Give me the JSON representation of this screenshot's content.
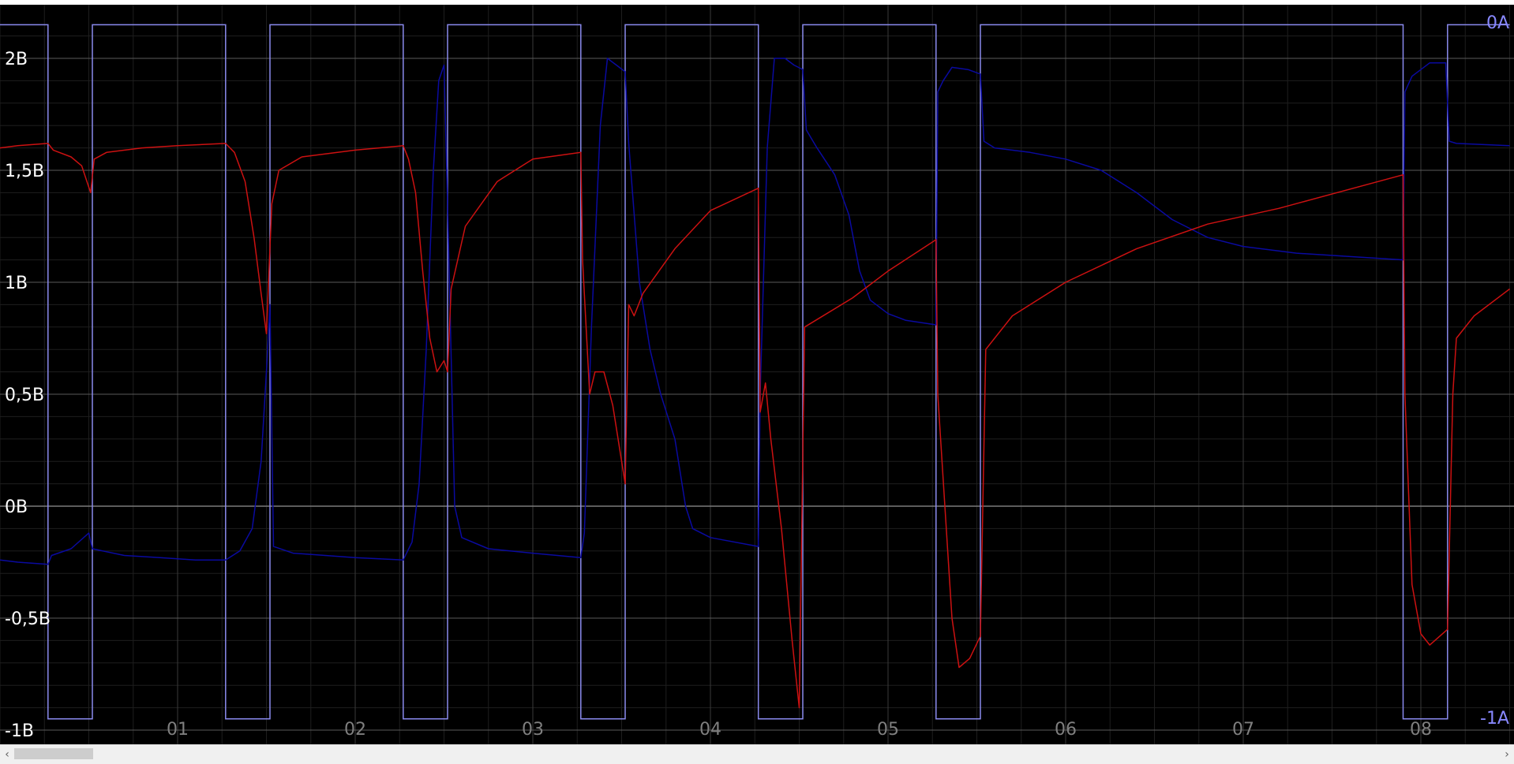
{
  "chart_data": {
    "type": "line",
    "title": "",
    "xlabel": "",
    "ylabel": "",
    "background": "#000000",
    "grid": true,
    "legend": "none",
    "xlim": [
      0,
      8.5
    ],
    "ylim": [
      -1.0,
      2.15
    ],
    "x_ticks": [
      {
        "value": 1,
        "label": "01"
      },
      {
        "value": 2,
        "label": "02"
      },
      {
        "value": 3,
        "label": "03"
      },
      {
        "value": 4,
        "label": "04"
      },
      {
        "value": 5,
        "label": "05"
      },
      {
        "value": 6,
        "label": "06"
      },
      {
        "value": 7,
        "label": "07"
      },
      {
        "value": 8,
        "label": "08"
      }
    ],
    "y_ticks": [
      {
        "value": 2,
        "label": "2В"
      },
      {
        "value": 1.5,
        "label": "1,5В"
      },
      {
        "value": 1,
        "label": "1В"
      },
      {
        "value": 0.5,
        "label": "0,5В"
      },
      {
        "value": 0,
        "label": "0В"
      },
      {
        "value": -0.5,
        "label": "-0,5В"
      },
      {
        "value": -1,
        "label": "-1В"
      }
    ],
    "y2_ticks": [
      {
        "value": 2.15,
        "label": "0A"
      },
      {
        "value": -0.95,
        "label": "-1A"
      }
    ],
    "series": [
      {
        "color": "#8a8aee",
        "style": "square",
        "high": 2.15,
        "low": -0.95,
        "low_intervals": [
          [
            0.27,
            0.52
          ],
          [
            1.27,
            1.52
          ],
          [
            2.27,
            2.52
          ],
          [
            3.27,
            3.52
          ],
          [
            4.27,
            4.52
          ],
          [
            5.27,
            5.52
          ],
          [
            7.9,
            8.15
          ]
        ]
      },
      {
        "color": "#0a0aa0",
        "points": [
          [
            0,
            -0.24
          ],
          [
            0.1,
            -0.25
          ],
          [
            0.27,
            -0.26
          ],
          [
            0.29,
            -0.22
          ],
          [
            0.4,
            -0.19
          ],
          [
            0.5,
            -0.12
          ],
          [
            0.52,
            -0.19
          ],
          [
            0.7,
            -0.22
          ],
          [
            0.9,
            -0.23
          ],
          [
            1.1,
            -0.24
          ],
          [
            1.27,
            -0.24
          ],
          [
            1.35,
            -0.2
          ],
          [
            1.42,
            -0.1
          ],
          [
            1.47,
            0.2
          ],
          [
            1.5,
            0.6
          ],
          [
            1.52,
            0.9
          ],
          [
            1.54,
            -0.18
          ],
          [
            1.65,
            -0.21
          ],
          [
            2,
            -0.23
          ],
          [
            2.27,
            -0.24
          ],
          [
            2.32,
            -0.16
          ],
          [
            2.36,
            0.1
          ],
          [
            2.4,
            0.7
          ],
          [
            2.44,
            1.5
          ],
          [
            2.47,
            1.9
          ],
          [
            2.5,
            1.97
          ],
          [
            2.52,
            1.35
          ],
          [
            2.56,
            0.0
          ],
          [
            2.6,
            -0.14
          ],
          [
            2.75,
            -0.19
          ],
          [
            3,
            -0.21
          ],
          [
            3.27,
            -0.23
          ],
          [
            3.29,
            -0.12
          ],
          [
            3.33,
            0.8
          ],
          [
            3.38,
            1.7
          ],
          [
            3.42,
            2.0
          ],
          [
            3.47,
            1.97
          ],
          [
            3.52,
            1.94
          ],
          [
            3.54,
            1.62
          ],
          [
            3.6,
            1.0
          ],
          [
            3.66,
            0.7
          ],
          [
            3.72,
            0.5
          ],
          [
            3.8,
            0.3
          ],
          [
            3.86,
            0.0
          ],
          [
            3.9,
            -0.1
          ],
          [
            4,
            -0.14
          ],
          [
            4.27,
            -0.18
          ],
          [
            4.28,
            0.5
          ],
          [
            4.32,
            1.6
          ],
          [
            4.36,
            2.0
          ],
          [
            4.42,
            2.0
          ],
          [
            4.47,
            1.97
          ],
          [
            4.52,
            1.95
          ],
          [
            4.54,
            1.68
          ],
          [
            4.6,
            1.6
          ],
          [
            4.7,
            1.48
          ],
          [
            4.78,
            1.3
          ],
          [
            4.84,
            1.05
          ],
          [
            4.9,
            0.92
          ],
          [
            5,
            0.86
          ],
          [
            5.1,
            0.83
          ],
          [
            5.27,
            0.81
          ],
          [
            5.28,
            1.85
          ],
          [
            5.31,
            1.9
          ],
          [
            5.36,
            1.96
          ],
          [
            5.45,
            1.95
          ],
          [
            5.52,
            1.93
          ],
          [
            5.54,
            1.63
          ],
          [
            5.6,
            1.6
          ],
          [
            5.8,
            1.58
          ],
          [
            6,
            1.55
          ],
          [
            6.2,
            1.5
          ],
          [
            6.4,
            1.4
          ],
          [
            6.6,
            1.28
          ],
          [
            6.8,
            1.2
          ],
          [
            7,
            1.16
          ],
          [
            7.3,
            1.13
          ],
          [
            7.9,
            1.1
          ],
          [
            7.91,
            1.85
          ],
          [
            7.95,
            1.92
          ],
          [
            8.05,
            1.98
          ],
          [
            8.14,
            1.98
          ],
          [
            8.16,
            1.63
          ],
          [
            8.2,
            1.62
          ],
          [
            8.5,
            1.61
          ]
        ]
      },
      {
        "color": "#cc1111",
        "points": [
          [
            0,
            1.6
          ],
          [
            0.1,
            1.61
          ],
          [
            0.27,
            1.62
          ],
          [
            0.3,
            1.59
          ],
          [
            0.4,
            1.56
          ],
          [
            0.46,
            1.52
          ],
          [
            0.51,
            1.4
          ],
          [
            0.53,
            1.55
          ],
          [
            0.6,
            1.58
          ],
          [
            0.8,
            1.6
          ],
          [
            1,
            1.61
          ],
          [
            1.27,
            1.62
          ],
          [
            1.32,
            1.58
          ],
          [
            1.38,
            1.45
          ],
          [
            1.43,
            1.2
          ],
          [
            1.47,
            0.95
          ],
          [
            1.5,
            0.77
          ],
          [
            1.53,
            1.35
          ],
          [
            1.57,
            1.5
          ],
          [
            1.7,
            1.56
          ],
          [
            2,
            1.59
          ],
          [
            2.27,
            1.61
          ],
          [
            2.3,
            1.55
          ],
          [
            2.34,
            1.4
          ],
          [
            2.38,
            1.05
          ],
          [
            2.42,
            0.75
          ],
          [
            2.46,
            0.6
          ],
          [
            2.5,
            0.65
          ],
          [
            2.52,
            0.6
          ],
          [
            2.54,
            0.97
          ],
          [
            2.62,
            1.25
          ],
          [
            2.8,
            1.45
          ],
          [
            3,
            1.55
          ],
          [
            3.27,
            1.58
          ],
          [
            3.28,
            1.1
          ],
          [
            3.32,
            0.5
          ],
          [
            3.35,
            0.6
          ],
          [
            3.4,
            0.6
          ],
          [
            3.45,
            0.45
          ],
          [
            3.52,
            0.1
          ],
          [
            3.54,
            0.9
          ],
          [
            3.57,
            0.85
          ],
          [
            3.62,
            0.95
          ],
          [
            3.8,
            1.15
          ],
          [
            4,
            1.32
          ],
          [
            4.27,
            1.42
          ],
          [
            4.28,
            0.42
          ],
          [
            4.31,
            0.55
          ],
          [
            4.34,
            0.3
          ],
          [
            4.4,
            -0.1
          ],
          [
            4.46,
            -0.6
          ],
          [
            4.5,
            -0.9
          ],
          [
            4.53,
            0.8
          ],
          [
            4.8,
            0.93
          ],
          [
            5,
            1.05
          ],
          [
            5.27,
            1.19
          ],
          [
            5.28,
            0.5
          ],
          [
            5.32,
            0.0
          ],
          [
            5.36,
            -0.5
          ],
          [
            5.4,
            -0.72
          ],
          [
            5.46,
            -0.68
          ],
          [
            5.52,
            -0.58
          ],
          [
            5.55,
            0.7
          ],
          [
            5.7,
            0.85
          ],
          [
            6,
            1.0
          ],
          [
            6.4,
            1.15
          ],
          [
            6.8,
            1.26
          ],
          [
            7.2,
            1.33
          ],
          [
            7.9,
            1.48
          ],
          [
            7.91,
            0.5
          ],
          [
            7.95,
            -0.35
          ],
          [
            8,
            -0.57
          ],
          [
            8.05,
            -0.62
          ],
          [
            8.15,
            -0.55
          ],
          [
            8.18,
            0.5
          ],
          [
            8.2,
            0.75
          ],
          [
            8.3,
            0.85
          ],
          [
            8.5,
            0.97
          ]
        ]
      }
    ]
  },
  "scrollbar": {
    "left_arrow": "‹",
    "right_arrow": "›"
  }
}
